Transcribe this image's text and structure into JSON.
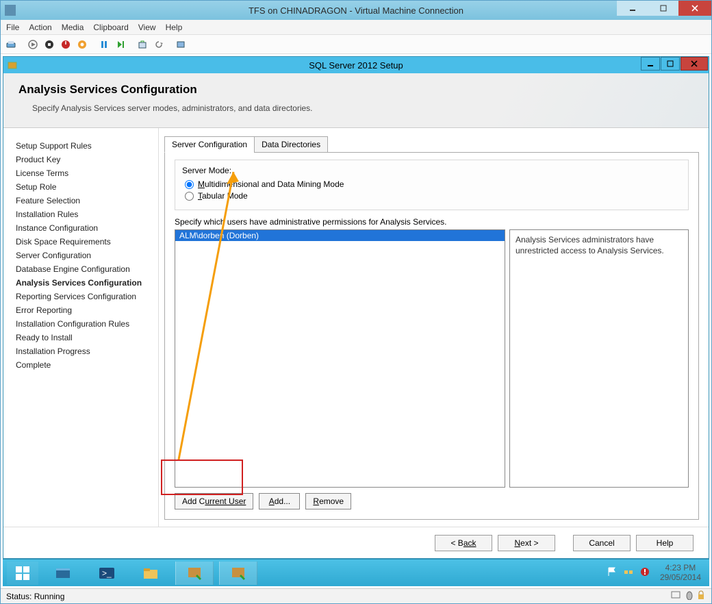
{
  "outer": {
    "title": "TFS on CHINADRAGON - Virtual Machine Connection",
    "menu": [
      "File",
      "Action",
      "Media",
      "Clipboard",
      "View",
      "Help"
    ]
  },
  "inner": {
    "title": "SQL Server 2012 Setup",
    "header_title": "Analysis Services Configuration",
    "header_sub": "Specify Analysis Services server modes, administrators, and data directories."
  },
  "nav": [
    "Setup Support Rules",
    "Product Key",
    "License Terms",
    "Setup Role",
    "Feature Selection",
    "Installation Rules",
    "Instance Configuration",
    "Disk Space Requirements",
    "Server Configuration",
    "Database Engine Configuration",
    "Analysis Services Configuration",
    "Reporting Services Configuration",
    "Error Reporting",
    "Installation Configuration Rules",
    "Ready to Install",
    "Installation Progress",
    "Complete"
  ],
  "nav_current": 10,
  "tabs": {
    "active": "Server Configuration",
    "other": "Data Directories"
  },
  "mode": {
    "label": "Server Mode:",
    "opt1": "ultidimensional and Data Mining Mode",
    "opt1_prefix": "M",
    "opt2": "abular Mode",
    "opt2_prefix": "T"
  },
  "perm_label": "Specify which users have administrative permissions for Analysis Services.",
  "user": "ALM\\dorben (Dorben)",
  "info": "Analysis Services administrators have unrestricted access to Analysis Services.",
  "buttons": {
    "add_current": "urrent User",
    "add_current_prefix": "Add C",
    "add": "dd...",
    "add_prefix": "A",
    "remove": "emove",
    "remove_prefix": "R"
  },
  "wizard": {
    "back": "ack",
    "back_prefix": "< B",
    "next": "ext >",
    "next_prefix": "N",
    "cancel": "Cancel",
    "help": "Help"
  },
  "tray": {
    "time": "4:23 PM",
    "date": "29/05/2014"
  },
  "status": "Status: Running"
}
